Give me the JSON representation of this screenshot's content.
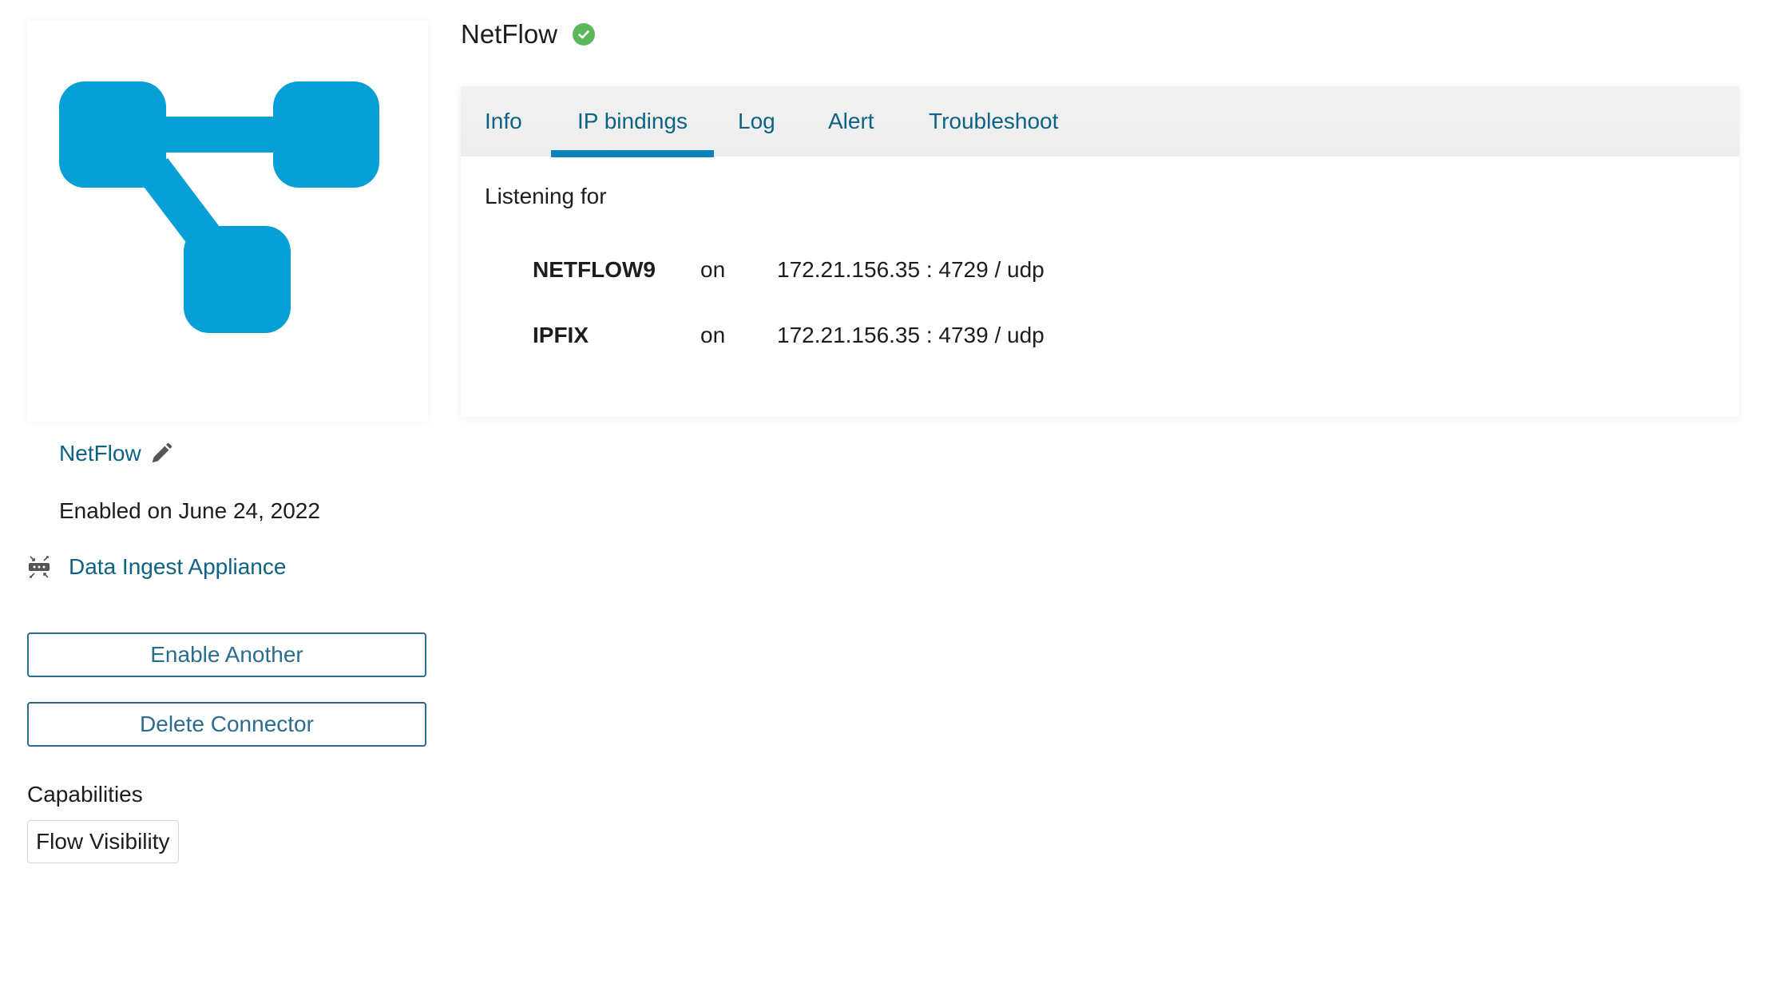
{
  "header": {
    "title": "NetFlow",
    "status_icon": "check-circle-icon",
    "status_color": "#5cb85c"
  },
  "logo": {
    "icon": "netflow-topology-logo",
    "color": "#069fd6"
  },
  "sidebar": {
    "connector_name": "NetFlow",
    "edit_icon": "pencil-icon",
    "enabled_text": "Enabled on June 24, 2022",
    "appliance_icon": "appliance-icon",
    "appliance_label": "Data Ingest Appliance",
    "enable_another_label": "Enable Another",
    "delete_connector_label": "Delete Connector",
    "capabilities_heading": "Capabilities",
    "capabilities": [
      "Flow Visibility"
    ]
  },
  "tabs": [
    {
      "label": "Info",
      "active": false
    },
    {
      "label": "IP bindings",
      "active": true
    },
    {
      "label": "Log",
      "active": false
    },
    {
      "label": "Alert",
      "active": false
    },
    {
      "label": "Troubleshoot",
      "active": false
    }
  ],
  "ip_bindings": {
    "heading": "Listening for",
    "rows": [
      {
        "protocol": "NETFLOW9",
        "on": "on",
        "address": "172.21.156.35 : 4729 / udp"
      },
      {
        "protocol": "IPFIX",
        "on": "on",
        "address": "172.21.156.35 : 4739 / udp"
      }
    ]
  },
  "colors": {
    "link": "#0d6384",
    "button_border": "#2b6d8e",
    "tab_underline": "#0882b8",
    "tab_bar_bg": "#f0f0f0"
  }
}
